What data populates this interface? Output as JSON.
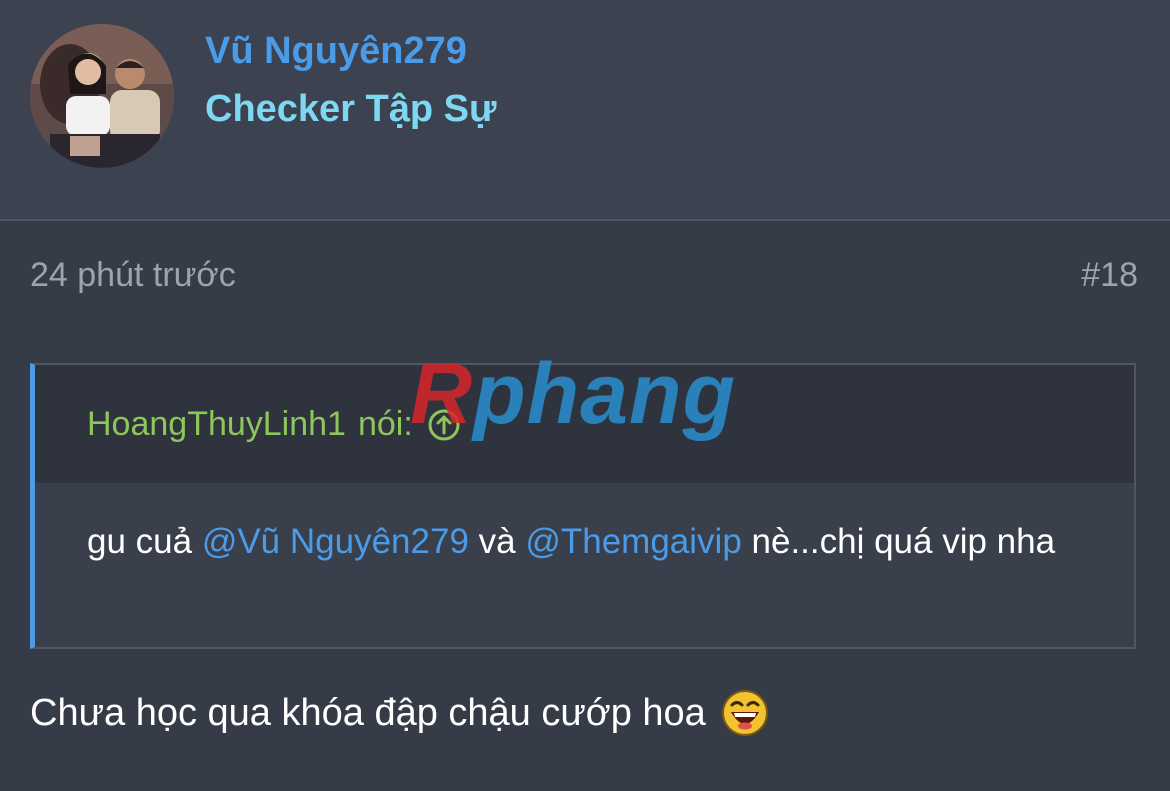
{
  "author": {
    "username": "Vũ Nguyên279",
    "title": "Checker Tập Sự"
  },
  "post": {
    "time": "24 phút trước",
    "number": "#18"
  },
  "quote": {
    "author": "HoangThuyLinh1",
    "said": "nói:",
    "text_before": "gu cuả ",
    "mention_1": "@Vũ Nguyên279",
    "text_middle": " và ",
    "mention_2": "@Themgaivip",
    "text_after": " nè...chị quá vip nha"
  },
  "message": {
    "text": "Chưa học qua khóa đập chậu cướp hoa"
  },
  "watermark": {
    "text_part_1": "R",
    "text_part_2": "phang"
  },
  "colors": {
    "background": "#363b48",
    "header_background": "#3d4250",
    "username": "#4a9be8",
    "user_title": "#7fd8f2",
    "quote_author": "#8dc65a",
    "mention": "#4a9be8",
    "muted_text": "#9ea3ae"
  }
}
